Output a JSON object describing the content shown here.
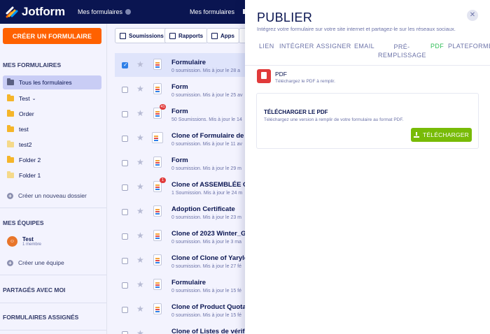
{
  "topbar": {
    "logo_text": "Jotform",
    "my_forms_label": "Mes formulaires",
    "center_label": "Mes formulaires"
  },
  "sidebar": {
    "create_button": "CRÉER UN FORMULAIRE",
    "my_forms_title": "MES FORMULAIRES",
    "folders": [
      {
        "label": "Tous les formulaires",
        "color": "#5a5f82"
      },
      {
        "label": "Test",
        "color": "#f5b52a"
      },
      {
        "label": "Order",
        "color": "#f5b52a"
      },
      {
        "label": "test",
        "color": "#f5b52a"
      },
      {
        "label": "test2",
        "color": "#f5d98a"
      },
      {
        "label": "Folder 2",
        "color": "#f5b52a"
      },
      {
        "label": "Folder 1",
        "color": "#f5d98a"
      }
    ],
    "new_folder": "Créer un nouveau dossier",
    "teams_title": "MES ÉQUIPES",
    "team_name": "Test",
    "team_members": "1 membre",
    "create_team": "Créer une équipe",
    "shared_title": "PARTAGÉS AVEC MOI",
    "assigned_title": "FORMULAIRES ASSIGNÉS"
  },
  "toolbar": {
    "submissions": "Soumissions",
    "reports": "Rapports",
    "apps": "Apps"
  },
  "forms": [
    {
      "title": "Formulaire",
      "sub": "0 soumission. Mis à jour le 28 a",
      "selected": true,
      "badge": ""
    },
    {
      "title": "Form",
      "sub": "0 soumission. Mis à jour le 25 av",
      "selected": false,
      "badge": ""
    },
    {
      "title": "Form",
      "sub": "50 Soumissions. Mis à jour le 14",
      "selected": false,
      "badge": "41"
    },
    {
      "title": "Clone of Formulaire de r",
      "sub": "0 soumission. Mis à jour le 11 av",
      "selected": false,
      "badge": ""
    },
    {
      "title": "Form",
      "sub": "0 soumission. Mis à jour le 29 m",
      "selected": false,
      "badge": ""
    },
    {
      "title": "Clone of ASSEMBLÉE GÉ",
      "sub": "1 Soumission. Mis à jour le 24 m",
      "selected": false,
      "badge": "1"
    },
    {
      "title": "Adoption Certificate",
      "sub": "0 soumission. Mis à jour le 23 m",
      "selected": false,
      "badge": ""
    },
    {
      "title": "Clone of 2023 Winter_G",
      "sub": "0 soumission. Mis à jour le 3 ma",
      "selected": false,
      "badge": ""
    },
    {
      "title": "Clone of Clone of Yarylo",
      "sub": "0 soumission. Mis à jour le 27 fé",
      "selected": false,
      "badge": ""
    },
    {
      "title": "Formulaire",
      "sub": "0 soumission. Mis à jour le 15 fé",
      "selected": false,
      "badge": ""
    },
    {
      "title": "Clone of Product Quotat",
      "sub": "0 soumission. Mis à jour le 15 fé",
      "selected": false,
      "badge": ""
    },
    {
      "title": "Clone of Listes de vérific",
      "sub": "",
      "selected": false,
      "badge": ""
    }
  ],
  "panel": {
    "title": "PUBLIER",
    "subtitle": "Intégrez votre formulaire sur votre site internet et partagez-le sur les réseaux sociaux.",
    "tabs": [
      "LIEN",
      "INTÉGRER",
      "ASSIGNER",
      "EMAIL",
      "PRÉ-\nREMPLISSAGE",
      "PDF",
      "PLATEFORMES"
    ],
    "active_tab": "PDF",
    "pdf_title": "PDF",
    "pdf_sub": "Téléchargez le PDF à remplir.",
    "card_title": "TÉLÉCHARGER LE PDF",
    "card_sub": "Téléchargez une version à remplir de votre formulaire au format PDF.",
    "download_button": "TÉLÉCHARGER"
  }
}
